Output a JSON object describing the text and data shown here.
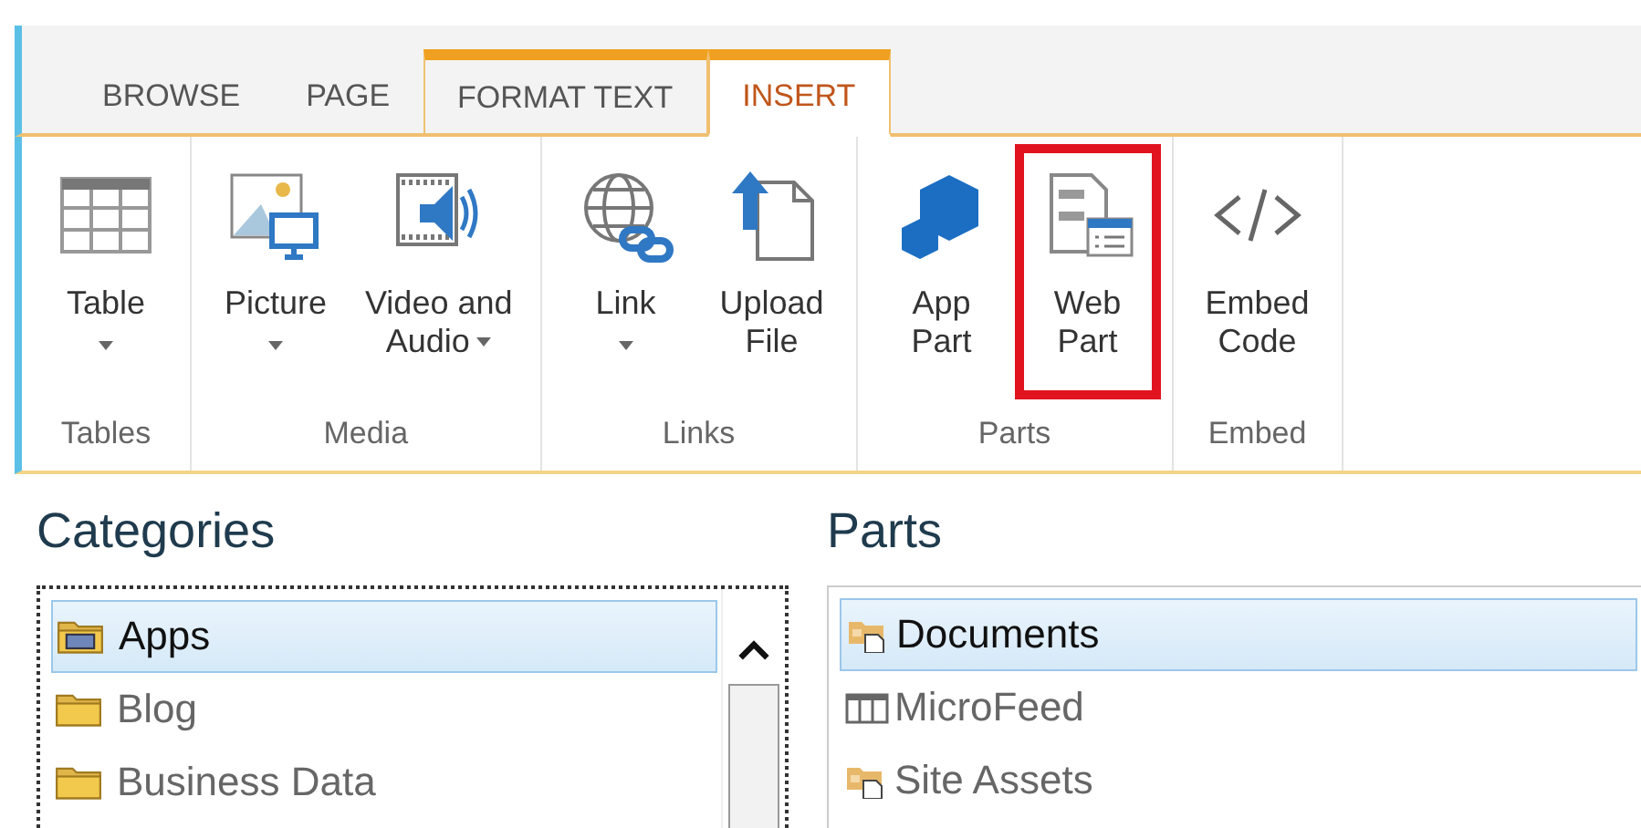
{
  "tabs": [
    {
      "label": "BROWSE",
      "selected": false,
      "contextual": false
    },
    {
      "label": "PAGE",
      "selected": false,
      "contextual": false
    },
    {
      "label": "FORMAT TEXT",
      "selected": false,
      "contextual": true
    },
    {
      "label": "INSERT",
      "selected": true,
      "contextual": true
    }
  ],
  "ribbon": {
    "groups": [
      {
        "label": "Tables",
        "buttons": [
          {
            "lines": [
              "Table"
            ],
            "dropdown": true,
            "highlighted": false
          }
        ]
      },
      {
        "label": "Media",
        "buttons": [
          {
            "lines": [
              "Picture"
            ],
            "dropdown": true,
            "highlighted": false
          },
          {
            "lines": [
              "Video and",
              "Audio"
            ],
            "dropdown": true,
            "highlighted": false
          }
        ]
      },
      {
        "label": "Links",
        "buttons": [
          {
            "lines": [
              "Link"
            ],
            "dropdown": true,
            "highlighted": false
          },
          {
            "lines": [
              "Upload",
              "File"
            ],
            "dropdown": false,
            "highlighted": false
          }
        ]
      },
      {
        "label": "Parts",
        "buttons": [
          {
            "lines": [
              "App",
              "Part"
            ],
            "dropdown": false,
            "highlighted": false
          },
          {
            "lines": [
              "Web",
              "Part"
            ],
            "dropdown": false,
            "highlighted": true
          }
        ]
      },
      {
        "label": "Embed",
        "buttons": [
          {
            "lines": [
              "Embed",
              "Code"
            ],
            "dropdown": false,
            "highlighted": false
          }
        ]
      }
    ]
  },
  "categories": {
    "title": "Categories",
    "items": [
      {
        "label": "Apps",
        "kind": "app-folder",
        "selected": true
      },
      {
        "label": "Blog",
        "kind": "folder",
        "selected": false
      },
      {
        "label": "Business Data",
        "kind": "folder",
        "selected": false
      }
    ]
  },
  "parts": {
    "title": "Parts",
    "items": [
      {
        "label": "Documents",
        "kind": "library",
        "selected": true
      },
      {
        "label": "MicroFeed",
        "kind": "list",
        "selected": false
      },
      {
        "label": "Site Assets",
        "kind": "library",
        "selected": false
      }
    ]
  }
}
